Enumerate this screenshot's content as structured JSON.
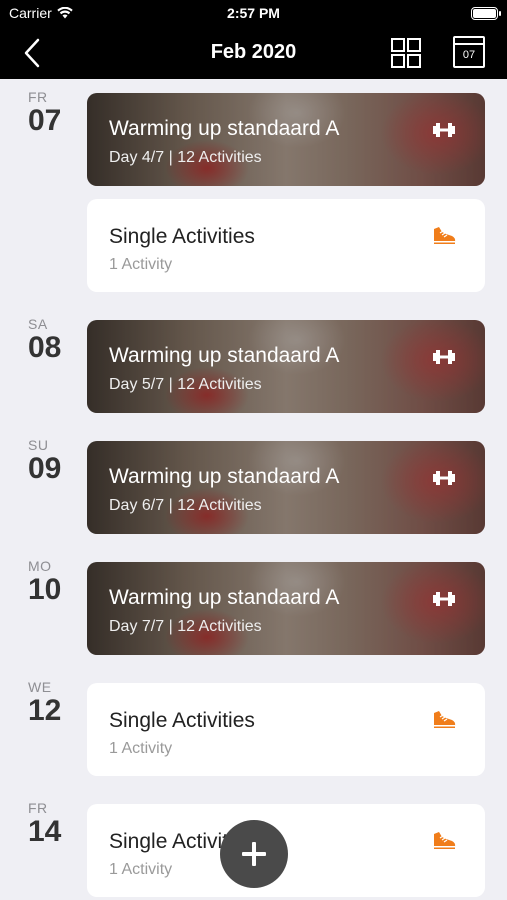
{
  "status_bar": {
    "carrier": "Carrier",
    "time": "2:57 PM"
  },
  "nav": {
    "title": "Feb 2020",
    "calendar_day": "07"
  },
  "days": [
    {
      "dow": "FR",
      "num": "07"
    },
    {
      "dow": "SA",
      "num": "08"
    },
    {
      "dow": "SU",
      "num": "09"
    },
    {
      "dow": "MO",
      "num": "10"
    },
    {
      "dow": "WE",
      "num": "12"
    },
    {
      "dow": "FR",
      "num": "14"
    }
  ],
  "cards": [
    {
      "title": "Warming up standaard A",
      "sub": "Day 4/7  |  12 Activities",
      "icon": "dumbbell-icon"
    },
    {
      "title": "Single Activities",
      "sub": "1 Activity",
      "icon": "sneaker-icon"
    },
    {
      "title": "Warming up standaard A",
      "sub": "Day 5/7  |  12 Activities",
      "icon": "dumbbell-icon"
    },
    {
      "title": "Warming up standaard A",
      "sub": "Day 6/7  |  12 Activities",
      "icon": "dumbbell-icon"
    },
    {
      "title": "Warming up standaard A",
      "sub": "Day 7/7  |  12 Activities",
      "icon": "dumbbell-icon"
    },
    {
      "title": "Single Activities",
      "sub": "1 Activity",
      "icon": "sneaker-icon"
    },
    {
      "title": "Single Activities",
      "sub": "1 Activity",
      "icon": "sneaker-icon"
    }
  ],
  "colors": {
    "accent": "#f07d1a",
    "nav_background": "#000000",
    "page_background": "#efeff4",
    "fab": "#4a4a4a"
  }
}
